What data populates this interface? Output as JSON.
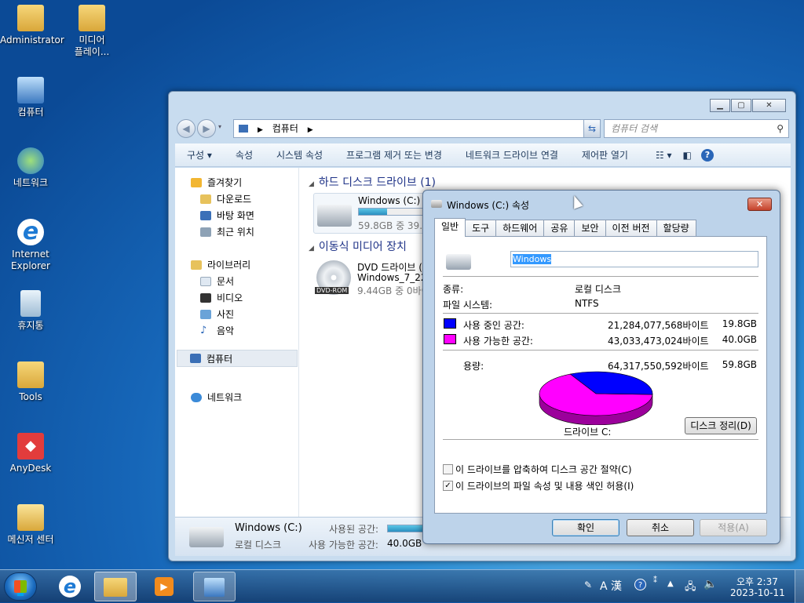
{
  "desktop": {
    "icons": [
      {
        "label": "Administrator",
        "color": "#e8c24a"
      },
      {
        "label": "미디어\n플레이...",
        "color": "#e8c24a"
      },
      {
        "label": "컴퓨터",
        "color": "#4a8ed8"
      },
      {
        "label": "네트워크",
        "color": "#3b8ad8"
      },
      {
        "label": "Internet Explorer",
        "color": "#3a9be0"
      },
      {
        "label": "휴지통",
        "color": "#cfe0ee"
      },
      {
        "label": "Tools",
        "color": "#e8c24a"
      },
      {
        "label": "AnyDesk",
        "color": "#e23c3c"
      },
      {
        "label": "메신저 센터",
        "color": "#f0c84a"
      }
    ]
  },
  "explorer": {
    "address": {
      "crumb": "컴퓨터"
    },
    "search": {
      "placeholder": "컴퓨터 검색"
    },
    "toolbar": [
      "구성 ▾",
      "속성",
      "시스템 속성",
      "프로그램 제거 또는 변경",
      "네트워크 드라이브 연결",
      "제어판 열기"
    ],
    "nav": {
      "favorites": "즐겨찾기",
      "downloads": "다운로드",
      "desktop": "바탕 화면",
      "recent": "최근 위치",
      "libraries": "라이브러리",
      "documents": "문서",
      "video": "비디오",
      "pictures": "사진",
      "music": "음악",
      "computer": "컴퓨터",
      "network": "네트워크"
    },
    "groups": {
      "hdd": "하드 디스크 드라이브 (1)",
      "removable": "이동식 미디어 장치"
    },
    "drive_c": {
      "name": "Windows (C:)",
      "space": "59.8GB 중 39.9G",
      "used_fraction": 0.33
    },
    "dvd": {
      "name": "DVD 드라이브 (",
      "label": "Windows_7_22i",
      "space": "9.44GB 중 0바이",
      "badge": "DVD-ROM"
    },
    "details": {
      "name": "Windows (C:)",
      "type": "로컬 디스크",
      "used_label": "사용된 공간:",
      "free_label": "사용 가능한 공간:",
      "free_value": "40.0GB"
    }
  },
  "dialog": {
    "title": "Windows (C:) 속성",
    "tabs": [
      "일반",
      "도구",
      "하드웨어",
      "공유",
      "보안",
      "이전 버전",
      "할당량"
    ],
    "volume_name": "Windows",
    "type_label": "종류:",
    "type_value": "로컬 디스크",
    "fs_label": "파일 시스템:",
    "fs_value": "NTFS",
    "used_label": "사용 중인 공간:",
    "used_bytes": "21,284,077,568바이트",
    "used_gb": "19.8GB",
    "used_color": "#0000ff",
    "free_label": "사용 가능한 공간:",
    "free_bytes": "43,033,473,024바이트",
    "free_gb": "40.0GB",
    "free_color": "#ff00ff",
    "cap_label": "용량:",
    "cap_bytes": "64,317,550,592바이트",
    "cap_gb": "59.8GB",
    "drive_label": "드라이브 C:",
    "cleanup": "디스크 정리(D)",
    "compress": "이 드라이브를 압축하여 디스크 공간 절약(C)",
    "compress_checked": false,
    "index": "이 드라이브의 파일 속성 및 내용 색인 허용(I)",
    "index_checked": true,
    "ok": "확인",
    "cancel": "취소",
    "apply": "적용(A)"
  },
  "taskbar": {
    "time": "오후 2:37",
    "date": "2023-10-11",
    "ime": "A 漢"
  }
}
